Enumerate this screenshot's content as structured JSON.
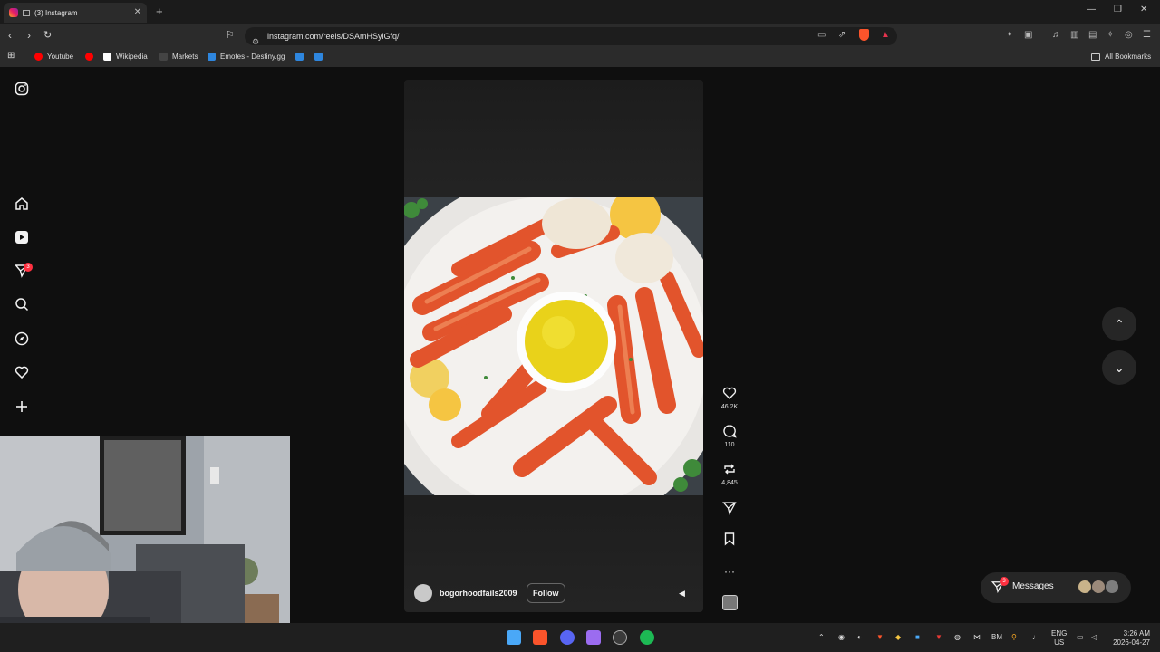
{
  "browser": {
    "tab_title": "(3) Instagram",
    "new_tab": "+",
    "url": "instagram.com/reels/DSAmHSyiGfq/",
    "bookmarks": [
      "Youtube",
      "Wikipedia",
      "Markets",
      "Emotes - Destiny.gg"
    ],
    "all_bookmarks": "All Bookmarks"
  },
  "sidebar": {
    "notification_count": "3"
  },
  "reel": {
    "likes": "46.2K",
    "comments": "110",
    "reposts": "4,845",
    "username": "bogorhoodfails2009",
    "follow_label": "Follow"
  },
  "messages": {
    "label": "Messages",
    "badge": "3"
  },
  "taskbar": {
    "lang_top": "ENG",
    "lang_bottom": "US",
    "time": "3:26 AM",
    "date": "2026-04-27",
    "bm": "BM"
  },
  "icons": {
    "instagram": "instagram-icon",
    "home": "home-icon",
    "reels": "reels-icon",
    "messages": "send-icon",
    "search": "search-icon",
    "explore": "compass-icon",
    "notifications": "heart-icon",
    "create": "plus-icon"
  }
}
